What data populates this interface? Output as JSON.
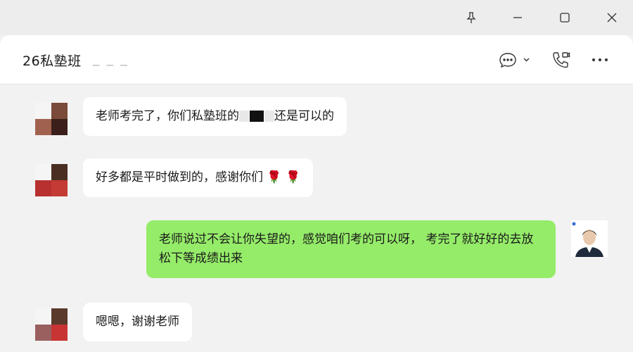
{
  "window": {
    "pin_icon": "pin-icon",
    "minimize_icon": "minimize-icon",
    "maximize_icon": "maximize-icon",
    "close_icon": "close-icon"
  },
  "header": {
    "title": "26私塾班",
    "title_suffix": "_ _ _",
    "chat_icon": "chat-bubble-icon",
    "call_icon": "phone-call-icon",
    "more_icon": "more-icon"
  },
  "messages": [
    {
      "direction": "in",
      "text_before": "老师考完了，你们私塾班的",
      "text_after": "还是可以的"
    },
    {
      "direction": "in",
      "text": "好多都是平时做到的，感谢你们",
      "emoji": "🌹 🌹"
    },
    {
      "direction": "out",
      "text": "老师说过不会让你失望的，感觉咱们考的可以呀， 考完了就好好的去放松下等成绩出来"
    },
    {
      "direction": "in",
      "text": "嗯嗯，谢谢老师"
    }
  ],
  "colors": {
    "outgoing_bubble": "#95ec69",
    "incoming_bubble": "#ffffff",
    "chat_background": "#f2f2f2"
  }
}
